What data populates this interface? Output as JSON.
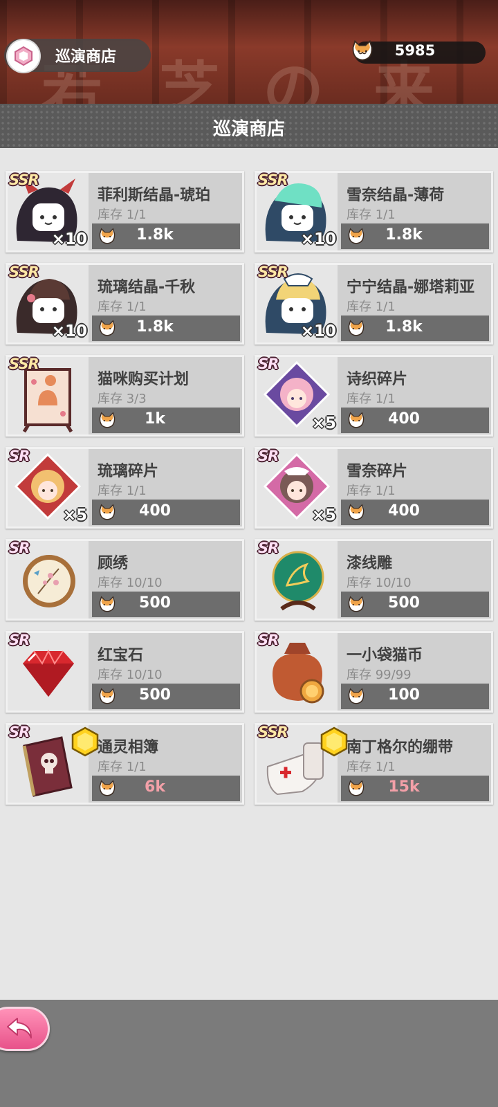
{
  "header": {
    "title": "巡演商店",
    "coin_balance": "5985",
    "background_glyphs": [
      "若",
      "芝",
      "の",
      "来"
    ]
  },
  "section_title": "巡演商店",
  "items": [
    {
      "rarity": "SSR",
      "name": "菲利斯结晶-琥珀",
      "stock": "库存 1/1",
      "quantity": "×10",
      "price": "1.8k",
      "icon": "amber-crystal-icon",
      "locked": false
    },
    {
      "rarity": "SSR",
      "name": "雪奈结晶-薄荷",
      "stock": "库存 1/1",
      "quantity": "×10",
      "price": "1.8k",
      "icon": "mint-crystal-icon",
      "locked": false
    },
    {
      "rarity": "SSR",
      "name": "琉璃结晶-千秋",
      "stock": "库存 1/1",
      "quantity": "×10",
      "price": "1.8k",
      "icon": "chiaki-crystal-icon",
      "locked": false
    },
    {
      "rarity": "SSR",
      "name": "宁宁结晶-娜塔莉亚",
      "stock": "库存 1/1",
      "quantity": "×10",
      "price": "1.8k",
      "icon": "natalia-crystal-icon",
      "locked": false
    },
    {
      "rarity": "SSR",
      "name": "猫咪购买计划",
      "stock": "库存 3/3",
      "quantity": "",
      "price": "1k",
      "icon": "cat-signboard-icon",
      "locked": false
    },
    {
      "rarity": "SR",
      "name": "诗织碎片",
      "stock": "库存 1/1",
      "quantity": "×5",
      "price": "400",
      "icon": "shiori-fragment-icon",
      "locked": false
    },
    {
      "rarity": "SR",
      "name": "琉璃碎片",
      "stock": "库存 1/1",
      "quantity": "×5",
      "price": "400",
      "icon": "ruri-fragment-icon",
      "locked": false
    },
    {
      "rarity": "SR",
      "name": "雪奈碎片",
      "stock": "库存 1/1",
      "quantity": "×5",
      "price": "400",
      "icon": "yukina-fragment-icon",
      "locked": false
    },
    {
      "rarity": "SR",
      "name": "顾绣",
      "stock": "库存 10/10",
      "quantity": "",
      "price": "500",
      "icon": "embroidery-hoop-icon",
      "locked": false
    },
    {
      "rarity": "SR",
      "name": "漆线雕",
      "stock": "库存 10/10",
      "quantity": "",
      "price": "500",
      "icon": "lacquer-plate-icon",
      "locked": false
    },
    {
      "rarity": "SR",
      "name": "红宝石",
      "stock": "库存 10/10",
      "quantity": "",
      "price": "500",
      "icon": "ruby-icon",
      "locked": false
    },
    {
      "rarity": "SR",
      "name": "一小袋猫币",
      "stock": "库存 99/99",
      "quantity": "",
      "price": "100",
      "icon": "coin-bag-icon",
      "locked": false
    },
    {
      "rarity": "SR",
      "name": "通灵相簿",
      "stock": "库存 1/1",
      "quantity": "",
      "price": "6k",
      "icon": "spirit-album-icon",
      "locked": true
    },
    {
      "rarity": "SSR",
      "name": "南丁格尔的绷带",
      "stock": "库存 1/1",
      "quantity": "",
      "price": "15k",
      "icon": "bandage-icon",
      "locked": true
    }
  ],
  "colors": {
    "price_bar": "#6d6d6d",
    "price_unaffordable": "#f3a0a8",
    "back_button": "#ee6a98"
  }
}
